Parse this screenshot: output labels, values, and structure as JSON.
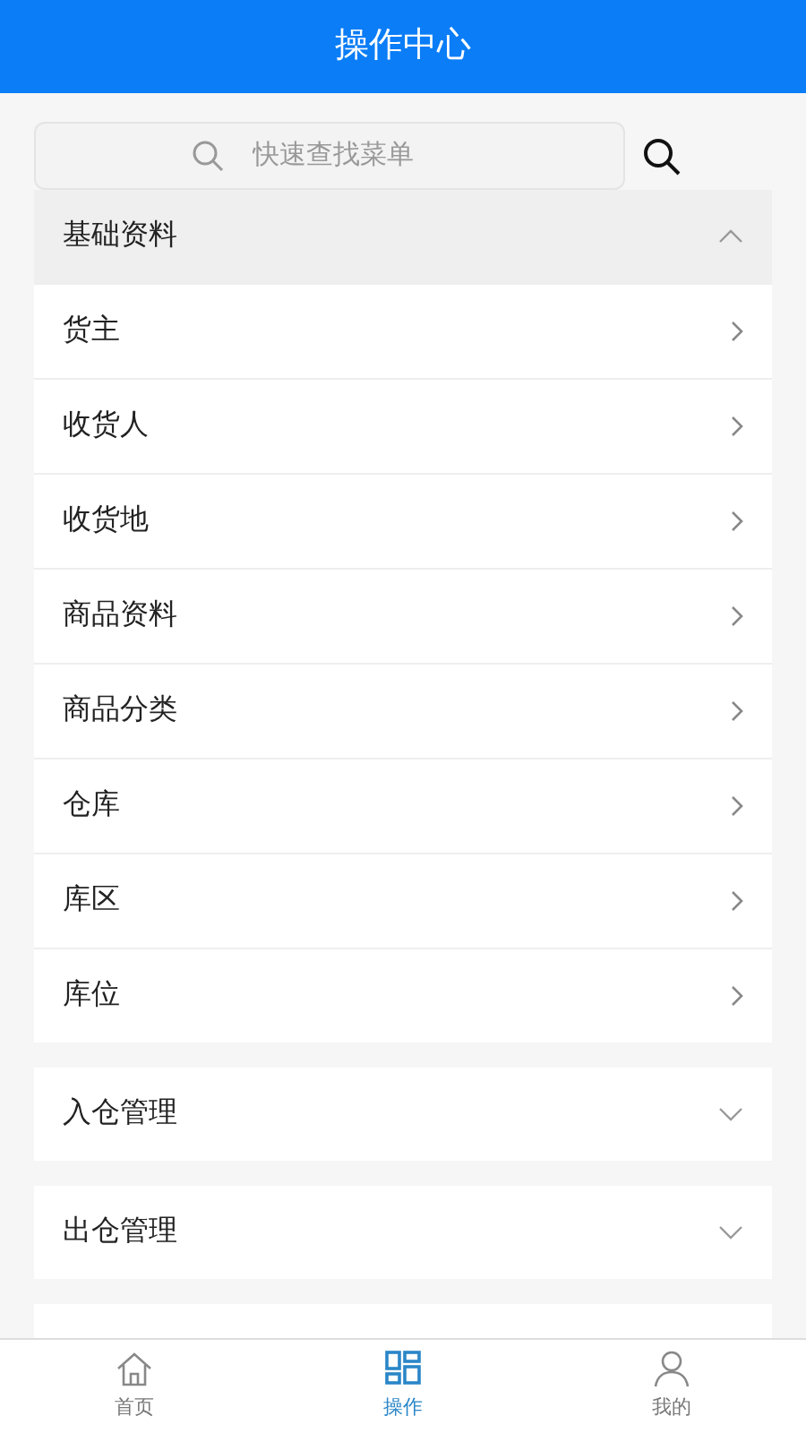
{
  "header": {
    "title": "操作中心"
  },
  "search": {
    "placeholder": "快速查找菜单"
  },
  "sections": [
    {
      "title": "基础资料",
      "expanded": true,
      "items": [
        "货主",
        "收货人",
        "收货地",
        "商品资料",
        "商品分类",
        "仓库",
        "库区",
        "库位"
      ]
    },
    {
      "title": "入仓管理",
      "expanded": false
    },
    {
      "title": "出仓管理",
      "expanded": false
    }
  ],
  "tabs": [
    {
      "label": "首页",
      "kind": "home",
      "selected": false
    },
    {
      "label": "操作",
      "kind": "operate",
      "selected": true
    },
    {
      "label": "我的",
      "kind": "profile",
      "selected": false
    }
  ]
}
